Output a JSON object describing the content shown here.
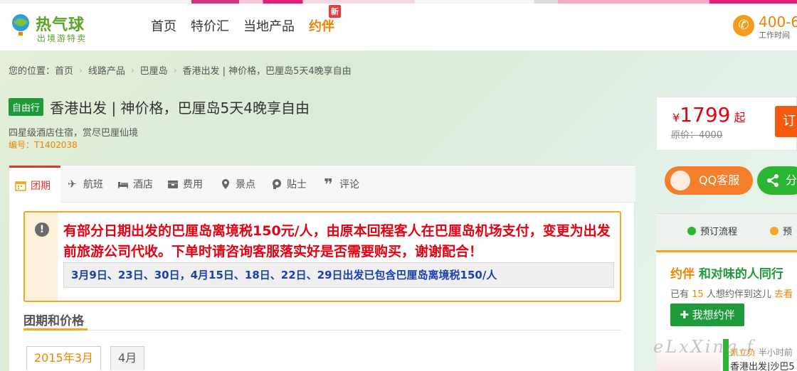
{
  "brand": {
    "name": "热气球",
    "slogan": "出境游特卖"
  },
  "nav": {
    "items": [
      "首页",
      "特价汇",
      "当地产品",
      "约伴"
    ],
    "new_badge": "新"
  },
  "phone": {
    "number": "400-6",
    "hours": "工作时间"
  },
  "breadcrumb": {
    "label": "您的位置：",
    "items": [
      "首页",
      "线路产品",
      "巴厘岛",
      "香港出发 | 神价格，巴厘岛5天4晚享自由"
    ]
  },
  "product": {
    "tag": "自由行",
    "title": "香港出发 | 神价格，巴厘岛5天4晚享自由",
    "subtitle": "四星级酒店住宿，赏尽巴厘仙境",
    "code": "编号：T1402038"
  },
  "price": {
    "currency": "¥",
    "amount": "1799",
    "suffix": "起",
    "original_label": "原价：",
    "original_value": "4000",
    "book_label": "订"
  },
  "tabs": [
    "团期",
    "航班",
    "酒店",
    "费用",
    "景点",
    "贴士",
    "评论"
  ],
  "notice": {
    "message": "有部分日期出发的巴厘岛离境税150元/人，由原本回程客人在巴厘岛机场支付，变更为出发前旅游公司代收。下单时请咨询客服落实好是否需要购买，谢谢配合！",
    "dates": "3月9日、23日、30日，4月15日、18日、22日、29日出发已包含巴厘岛离境税150/人"
  },
  "schedule": {
    "title": "团期和价格",
    "months": [
      "2015年3月",
      "4月"
    ]
  },
  "sidebar": {
    "qq_label": "QQ客服",
    "share_label": "分",
    "flow": [
      "预订流程",
      "预"
    ],
    "yueban": {
      "brand": "约伴",
      "title": "和对味的人同行",
      "count_prefix": "已有",
      "count": "15",
      "count_suffix": "人想约伴到这儿",
      "go": "去看",
      "button": "我想约伴",
      "feed_user": "凯立负",
      "feed_time": "半小时前",
      "feed_text": "香港出发|沙巴5"
    }
  },
  "watermark": "eLxXing.f",
  "colors": {
    "brand_green": "#5aa427",
    "accent_orange": "#f08300",
    "price_red": "#e60012",
    "notice_border": "#f6a623"
  }
}
